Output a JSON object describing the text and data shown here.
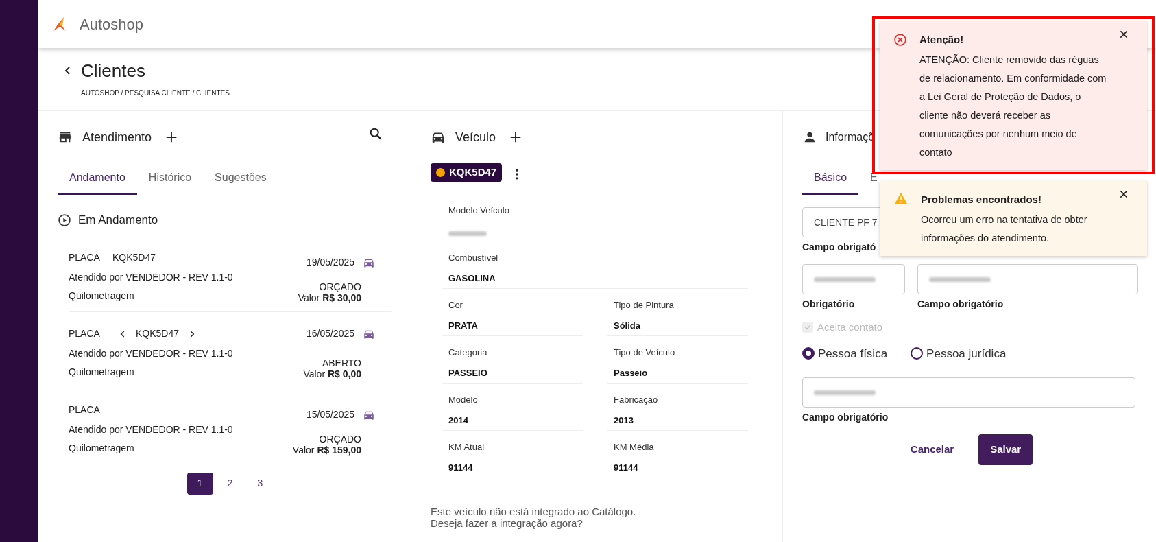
{
  "app": {
    "name": "Autoshop"
  },
  "page": {
    "title": "Clientes",
    "breadcrumb": "AUTOSHOP / PESQUISA CLIENTE / CLIENTES"
  },
  "atendimento": {
    "title": "Atendimento",
    "tabs": [
      {
        "label": "Andamento",
        "selected": true
      },
      {
        "label": "Histórico",
        "selected": false
      },
      {
        "label": "Sugestões",
        "selected": false
      }
    ],
    "section": "Em Andamento",
    "items": [
      {
        "placa_label": "PLACA",
        "plate": "KQK5D47",
        "plate_nav": false,
        "date": "19/05/2025",
        "attended_by": "Atendido por VENDEDOR - REV 1.1-0",
        "mileage_label": "Quilometragem",
        "status": "ORÇADO",
        "value": "Valor **R$ 30,00**"
      },
      {
        "placa_label": "PLACA",
        "plate": "KQK5D47",
        "plate_nav": true,
        "date": "16/05/2025",
        "attended_by": "Atendido por VENDEDOR - REV 1.1-0",
        "mileage_label": "Quilometragem",
        "status": "ABERTO",
        "value": "Valor **R$ 0,00**"
      },
      {
        "placa_label": "PLACA",
        "plate_nav": false,
        "date": "15/05/2025",
        "attended_by": "Atendido por VENDEDOR - REV 1.1-0",
        "mileage_label": "Quilometragem",
        "status": "ORÇADO",
        "value": "Valor **R$ 159,00**"
      }
    ],
    "pages": [
      {
        "label": "1",
        "selected": true
      },
      {
        "label": "2",
        "selected": false
      },
      {
        "label": "3",
        "selected": false
      }
    ]
  },
  "vehicle": {
    "title": "Veículo",
    "plate": "KQK5D47",
    "fields": [
      {
        "kind": "full",
        "label": "Modelo Veículo",
        "blurred": true
      },
      {
        "kind": "full",
        "label": "Combustível",
        "value": "GASOLINA"
      },
      {
        "kind": "half",
        "label": "Cor",
        "value": "PRATA"
      },
      {
        "kind": "half",
        "label": "Tipo de Pintura",
        "value": "Sólida"
      },
      {
        "kind": "half",
        "label": "Categoria",
        "value": "PASSEIO"
      },
      {
        "kind": "half",
        "label": "Tipo de Veículo",
        "value": "Passeio"
      },
      {
        "kind": "half",
        "label": "Modelo",
        "value": "2014"
      },
      {
        "kind": "half",
        "label": "Fabricação",
        "value": "2013"
      },
      {
        "kind": "half",
        "label": "KM Atual",
        "value": "91144"
      },
      {
        "kind": "half",
        "label": "KM Média",
        "value": "91144"
      }
    ],
    "note": [
      "Este veículo não está integrado ao Catálogo.",
      "Deseja fazer a integração agora?"
    ]
  },
  "cliente": {
    "title": "Informaçõ",
    "tabs": [
      {
        "label": "Básico",
        "selected": true
      },
      {
        "label": "E",
        "selected": false
      }
    ],
    "name_field": {
      "value": "CLIENTE PF 7",
      "hint": "Campo obrigató"
    },
    "row_fields": [
      {
        "hint": "Obrigatório",
        "blurred": true
      },
      {
        "hint": "Campo obrigatório",
        "blurred": true
      }
    ],
    "accept_contact": {
      "label": "Aceita contato",
      "checked": true,
      "disabled": true
    },
    "person_type": [
      {
        "label": "Pessoa física",
        "selected": true
      },
      {
        "label": "Pessoa jurídica",
        "selected": false
      }
    ],
    "doc_field": {
      "hint": "Campo obrigatório",
      "blurred": true
    },
    "cancel": "Cancelar",
    "save": "Salvar"
  },
  "toasts": [
    {
      "kind": "error",
      "highlighted": true,
      "title": "Atenção!",
      "message": "ATENÇÃO: Cliente removido das réguas de relacionamento. Em conformidade com a Lei Geral de Proteção de Dados, o cliente não deverá receber as comunicações por nenhum meio de contato"
    },
    {
      "kind": "warning",
      "highlighted": false,
      "title": "Problemas encontrados!",
      "message": "Ocorreu um erro na tentativa de obter informações do atendimento."
    }
  ]
}
